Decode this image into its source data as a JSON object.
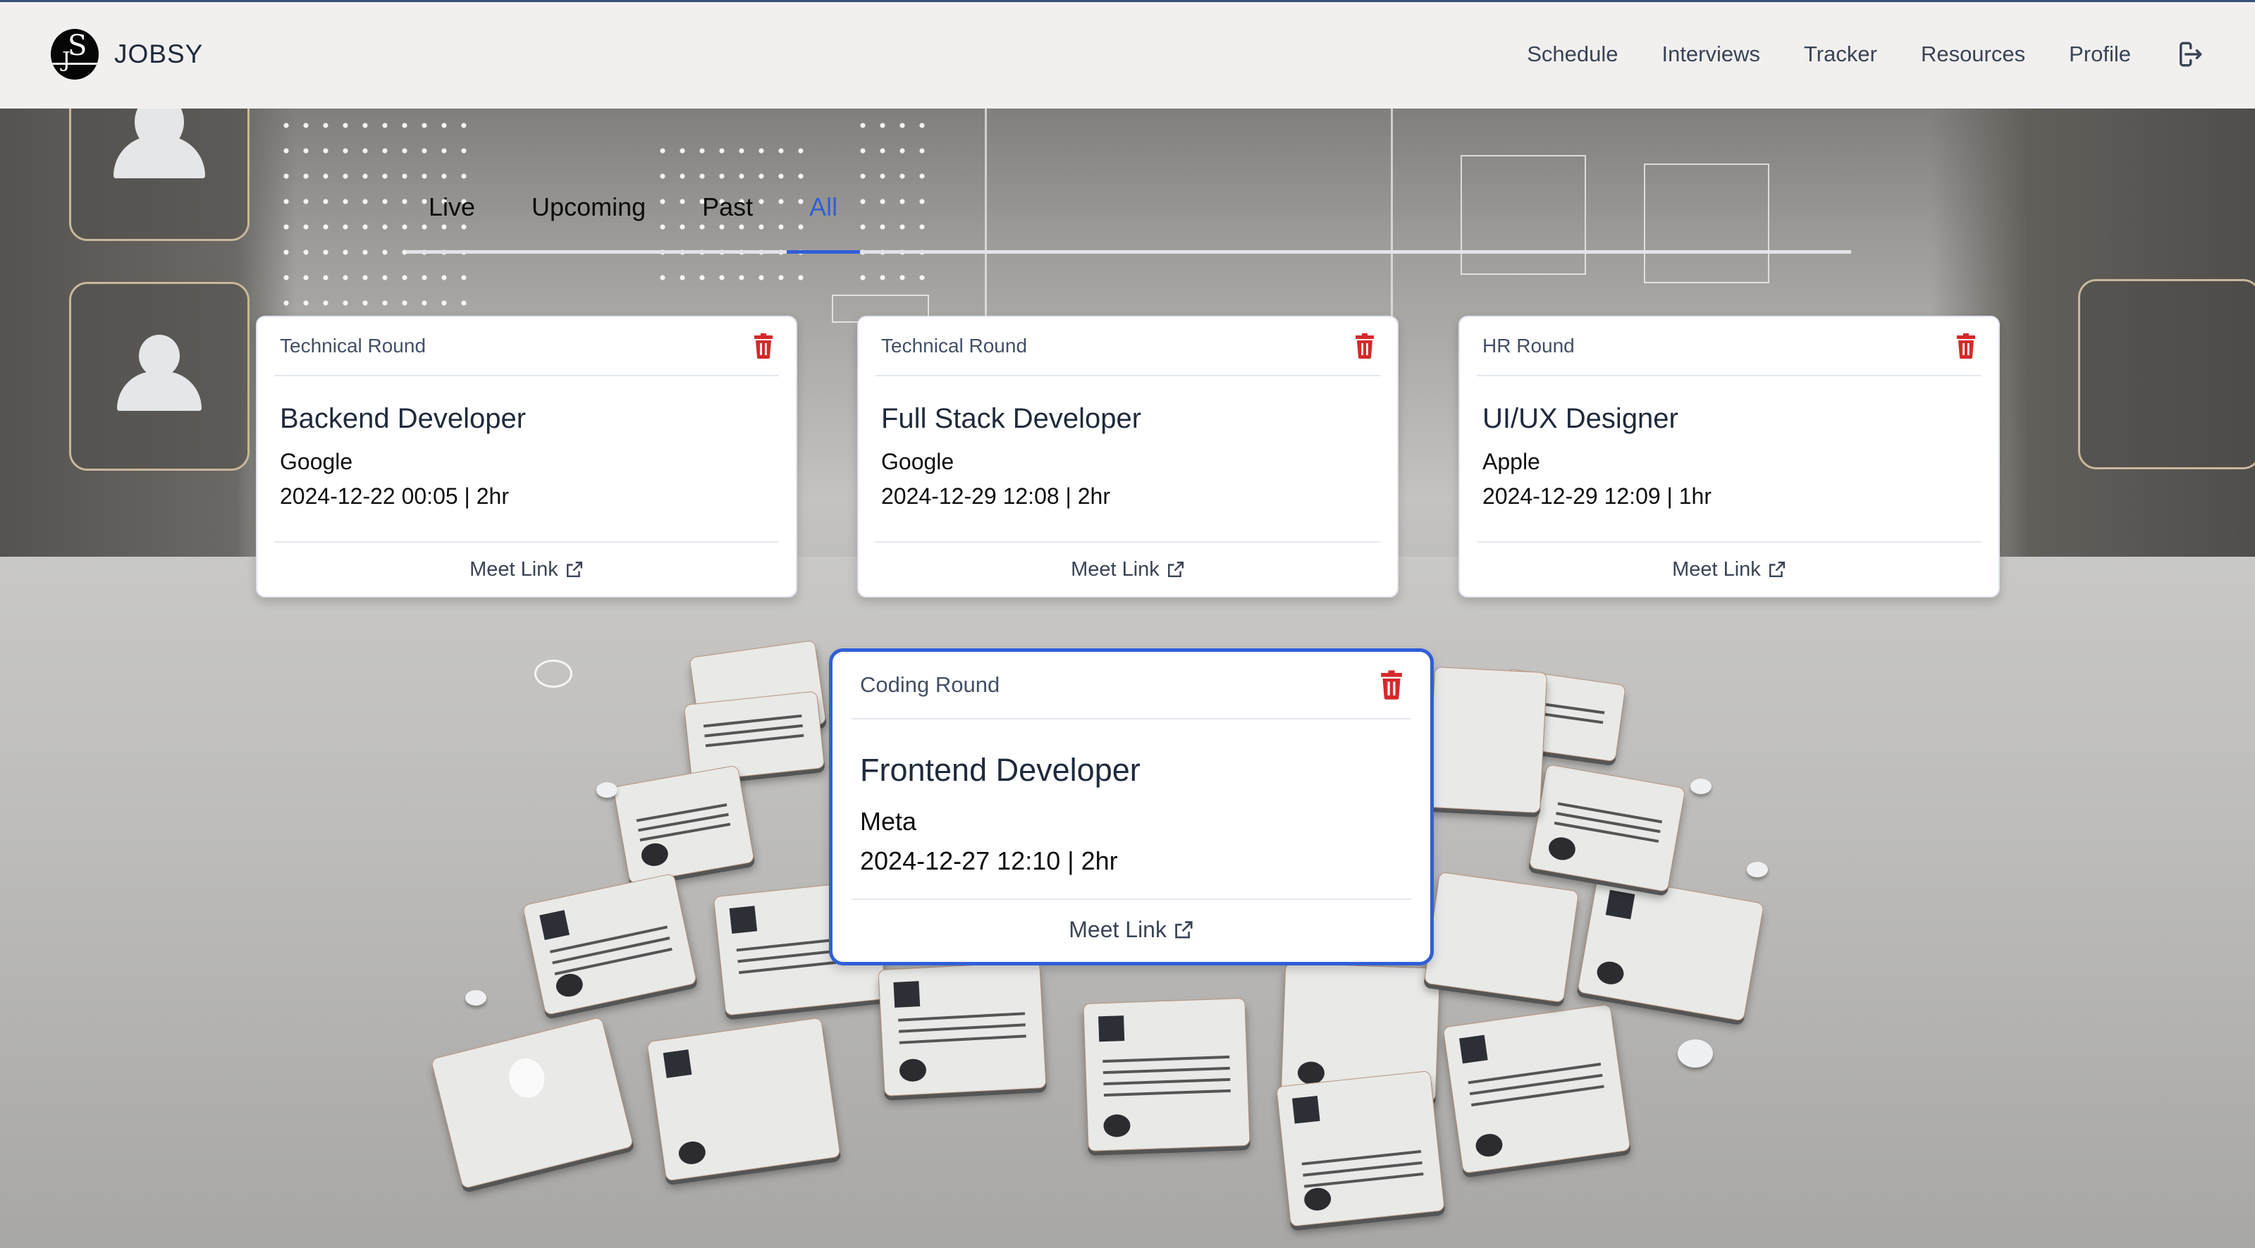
{
  "navbar": {
    "brand": "JOBSY",
    "links": [
      "Schedule",
      "Interviews",
      "Tracker",
      "Resources",
      "Profile"
    ],
    "logout_icon": "logout-icon"
  },
  "tabs": {
    "items": [
      "Live",
      "Upcoming",
      "Past",
      "All"
    ],
    "active": "All"
  },
  "colors": {
    "accent": "#2f5fd8",
    "delete": "#d42a2a",
    "title_text": "#1f2a3c",
    "muted_text": "#435066"
  },
  "interviews": [
    {
      "round": "Technical Round",
      "role": "Backend Developer",
      "company": "Google",
      "datetime": "2024-12-22 00:05 | 2hr",
      "link_label": "Meet Link",
      "icon": "trash-icon"
    },
    {
      "round": "Technical Round",
      "role": "Full Stack Developer",
      "company": "Google",
      "datetime": "2024-12-29 12:08 | 2hr",
      "link_label": "Meet Link",
      "icon": "trash-icon"
    },
    {
      "round": "HR Round",
      "role": "UI/UX Designer",
      "company": "Apple",
      "datetime": "2024-12-29 12:09 | 1hr",
      "link_label": "Meet Link",
      "icon": "trash-icon"
    },
    {
      "round": "Coding Round",
      "role": "Frontend Developer",
      "company": "Meta",
      "datetime": "2024-12-27 12:10 | 2hr",
      "link_label": "Meet Link",
      "icon": "trash-icon",
      "highlighted": true
    }
  ]
}
